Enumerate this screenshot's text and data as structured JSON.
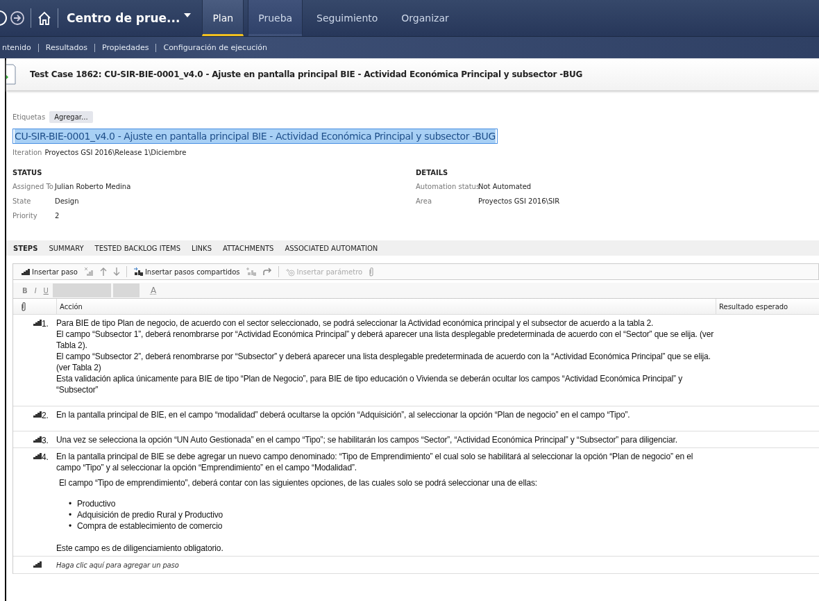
{
  "nav": {
    "project": "Centro de prue...",
    "tabs": [
      {
        "label": "Plan",
        "selected": true,
        "hover": false
      },
      {
        "label": "Prueba",
        "selected": false,
        "hover": true
      },
      {
        "label": "Seguimiento",
        "selected": false,
        "hover": false
      },
      {
        "label": "Organizar",
        "selected": false,
        "hover": false
      }
    ],
    "subnav": [
      "ntenido",
      "Resultados",
      "Propiedades",
      "Configuración de ejecución"
    ]
  },
  "work_item": {
    "title": "Test Case 1862: CU-SIR-BIE-0001_v4.0 - Ajuste en pantalla principal BIE - Actividad Económica Principal y subsector -BUG",
    "tags": {
      "label": "Etiquetas",
      "button": "Agregar..."
    },
    "name_field": {
      "value": "CU-SIR-BIE-0001_v4.0 - Ajuste en pantalla principal BIE - Actividad Económica Principal y subsector -BUG",
      "text_selected": true
    },
    "iteration": {
      "label": "Iteration",
      "value": "Proyectos GSI 2016\\Release 1\\Diciembre"
    },
    "status": {
      "heading": "STATUS",
      "fields": [
        {
          "label": "Assigned To",
          "value": "Julian Roberto Medina"
        },
        {
          "label": "State",
          "value": "Design"
        },
        {
          "label": "Priority",
          "value": "2"
        }
      ]
    },
    "details": {
      "heading": "DETAILS",
      "fields": [
        {
          "label": "Automation status",
          "value": "Not Automated"
        },
        {
          "label": "Area",
          "value": "Proyectos GSI 2016\\SIR"
        }
      ]
    },
    "section_tabs": [
      {
        "label": "STEPS",
        "selected": true
      },
      {
        "label": "SUMMARY",
        "selected": false
      },
      {
        "label": "TESTED BACKLOG ITEMS",
        "selected": false
      },
      {
        "label": "LINKS",
        "selected": false
      },
      {
        "label": "ATTACHMENTS",
        "selected": false
      },
      {
        "label": "ASSOCIATED AUTOMATION",
        "selected": false
      }
    ],
    "toolbar": {
      "insert_step": {
        "label": "Insertar paso",
        "disabled": false
      },
      "insert_shared": {
        "label": "Insertar pasos compartidos",
        "disabled": false
      },
      "insert_param": {
        "label": "Insertar parámetro",
        "disabled": true
      }
    },
    "format_bar": {
      "buttons": [
        "B",
        "I",
        "U"
      ],
      "font_color": "A"
    },
    "steps_grid": {
      "columns": [
        "Acción",
        "Resultado esperado"
      ],
      "steps": [
        {
          "number": "1.",
          "blocks": [
            {
              "kind": "para",
              "text": "Para BIE de tipo Plan de negocio, de acuerdo con el sector seleccionado, se podrá seleccionar la Actividad económica principal y el subsector de acuerdo a la tabla 2."
            },
            {
              "kind": "para",
              "text": "El campo “Subsector 1”, deberá renombrarse por “Actividad Económica Principal” y deberá aparecer una lista desplegable predeterminada de acuerdo con el “Sector” que se elija. (ver Tabla 2)."
            },
            {
              "kind": "para",
              "text": "El campo “Subsector 2”, deberá renombrarse por “Subsector” y deberá aparecer una lista desplegable predeterminada de acuerdo con la “Actividad Económica Principal” que se elija. (ver Tabla 2)"
            },
            {
              "kind": "para",
              "text": "Esta validación aplica únicamente para BIE de tipo “Plan de Negocio”, para BIE de tipo educación o Vivienda se deberán ocultar los campos “Actividad Económica Principal” y “Subsector”"
            },
            {
              "kind": "gap"
            }
          ]
        },
        {
          "number": "2.",
          "blocks": [
            {
              "kind": "para",
              "text": "En la pantalla principal de BIE, en el campo “modalidad” deberá ocultarse la opción “Adquisición”, al seleccionar la opción “Plan de negocio” en el campo “Tipo”."
            },
            {
              "kind": "gap"
            }
          ]
        },
        {
          "number": "3.",
          "blocks": [
            {
              "kind": "para",
              "text": "Una vez se selecciona la opción “UN Auto Gestionada” en el campo “Tipo”; se habilitarán los campos “Sector”, “Actividad Económica Principal” y “Subsector” para diligenciar."
            }
          ]
        },
        {
          "number": "4.",
          "blocks": [
            {
              "kind": "para",
              "text": "En la pantalla principal de BIE se debe agregar un nuevo campo denominado: “Tipo de Emprendimiento” el cual solo se habilitará al seleccionar la opción “Plan de negocio” en el campo “Tipo” y al seleccionar la opción “Emprendimiento” en el campo “Modalidad”."
            },
            {
              "kind": "indented",
              "text": "El campo “Tipo de emprendimiento”, deberá contar con las siguientes opciones, de las cuales solo se podrá seleccionar una de ellas:"
            },
            {
              "kind": "bullets",
              "items": [
                {
                  "marker": "•",
                  "text": "Productivo"
                },
                {
                  "marker": "•",
                  "text": "Adquisición de predio Rural y Productivo"
                },
                {
                  "marker": "•",
                  "text": "Compra de establecimiento de comercio"
                }
              ]
            },
            {
              "kind": "para",
              "text": "Este campo es de diligenciamiento obligatorio."
            }
          ]
        }
      ],
      "new_step_hint": "Haga clic aquí para agregar un paso"
    }
  }
}
